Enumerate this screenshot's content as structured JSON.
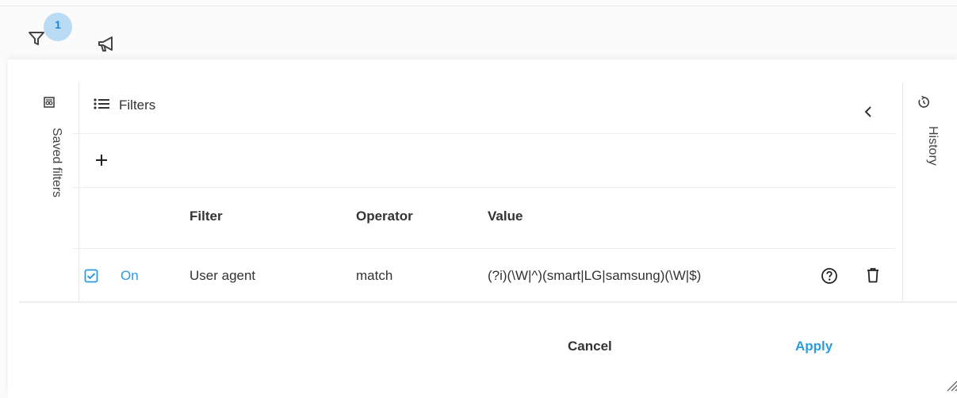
{
  "toolbar": {
    "filter_badge": "1",
    "filter_icon": "filter-icon",
    "announce_icon": "megaphone-icon"
  },
  "left_rail": {
    "label": "Saved filters",
    "icon": "saved-filters-icon"
  },
  "right_rail": {
    "label": "History",
    "icon": "history-icon"
  },
  "filters_panel": {
    "title": "Filters",
    "columns": [
      "Filter",
      "Operator",
      "Value"
    ],
    "rows": [
      {
        "checked": true,
        "status": "On",
        "filter": "User agent",
        "operator": "match",
        "value": "(?i)(\\W|^)(smart|LG|samsung)(\\W|$)"
      }
    ]
  },
  "actions": {
    "cancel": "Cancel",
    "apply": "Apply"
  },
  "colors": {
    "accent": "#2d9be0",
    "badge_bg": "#b9dcf4"
  }
}
